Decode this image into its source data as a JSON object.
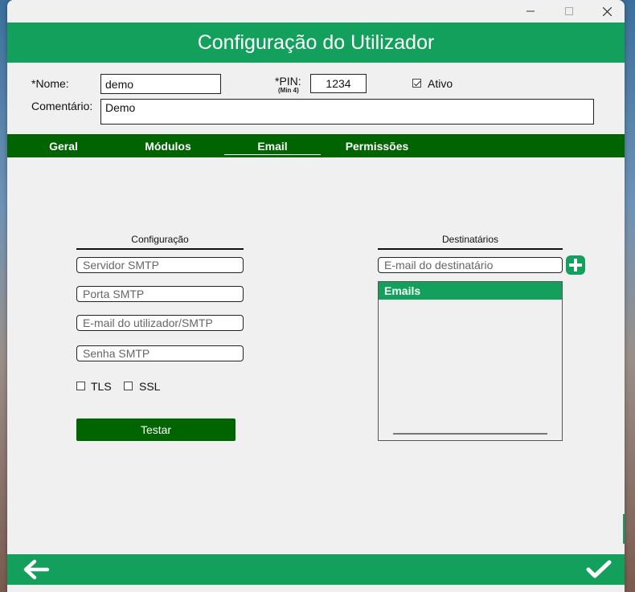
{
  "window": {
    "controls": {
      "minimize": "minimize-icon",
      "maximize": "maximize-icon",
      "close": "close-icon"
    }
  },
  "header": {
    "title": "Configuração do Utilizador"
  },
  "form": {
    "nome_label": "*Nome:",
    "nome_value": "demo",
    "pin_label": "*PIN:",
    "pin_hint": "(Min 4)",
    "pin_value": "1234",
    "ativo_label": "Ativo",
    "ativo_checked": true,
    "comentario_label": "Comentário:",
    "comentario_value": "Demo"
  },
  "tabs": [
    {
      "label": "Geral",
      "active": false
    },
    {
      "label": "Módulos",
      "active": false
    },
    {
      "label": "Email",
      "active": true
    },
    {
      "label": "Permissões",
      "active": false
    }
  ],
  "config": {
    "title": "Configuração",
    "smtp_server_placeholder": "Servidor SMTP",
    "smtp_port_placeholder": "Porta SMTP",
    "smtp_email_placeholder": "E-mail do utilizador/SMTP",
    "smtp_password_placeholder": "Senha SMTP",
    "tls_label": "TLS",
    "ssl_label": "SSL",
    "test_button": "Testar"
  },
  "recipients": {
    "title": "Destinatários",
    "email_placeholder": "E-mail do destinatário",
    "list_header": "Emails",
    "items": []
  },
  "footer": {
    "back_icon": "arrow-left-icon",
    "confirm_icon": "checkmark-icon"
  },
  "colors": {
    "accent": "#12a05c",
    "dark_green": "#006400",
    "background": "#f0f0f0"
  }
}
